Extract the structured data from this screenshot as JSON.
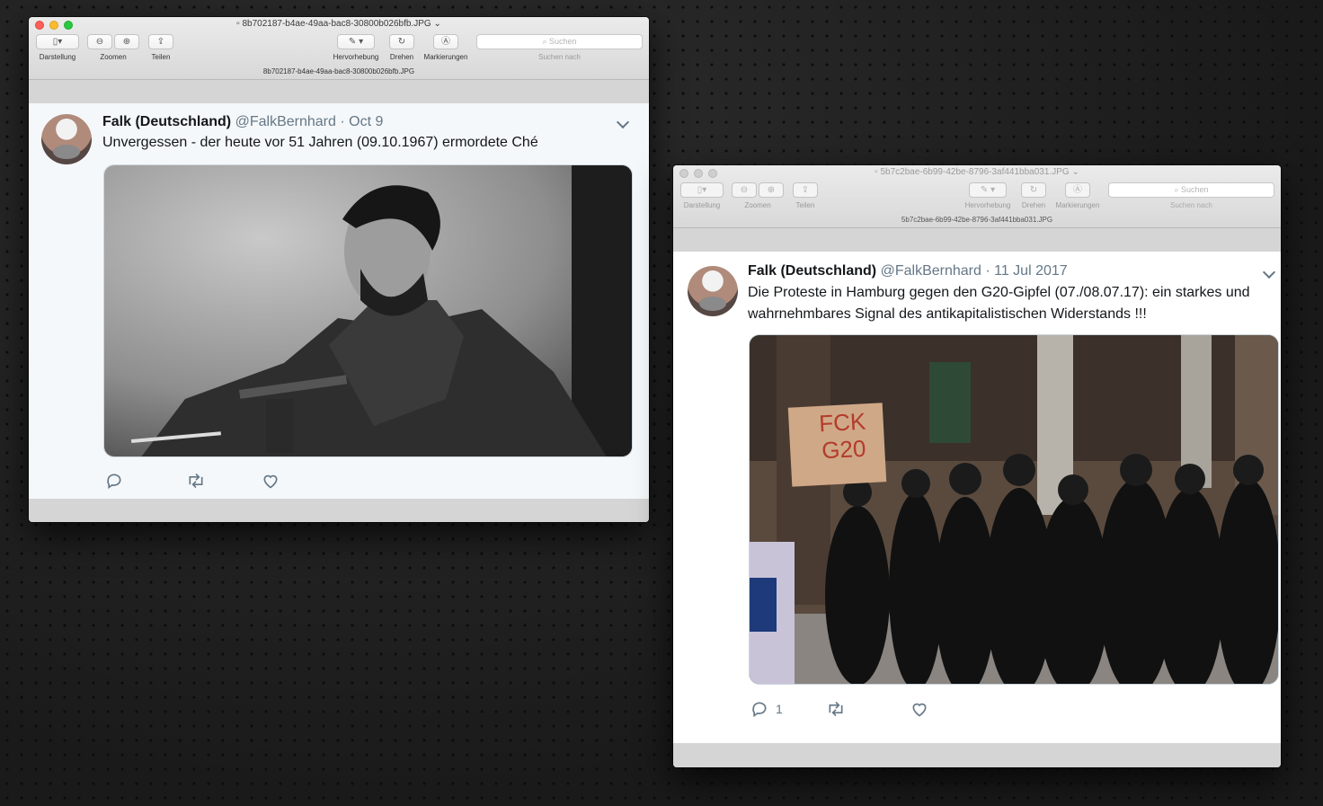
{
  "toolbar": {
    "view_label": "Darstellung",
    "zoom_label": "Zoomen",
    "share_label": "Teilen",
    "highlight_label": "Hervorhebung",
    "rotate_label": "Drehen",
    "markup_label": "Markierungen",
    "search_placeholder": "Suchen",
    "search_label": "Suchen nach"
  },
  "windows": [
    {
      "title": "8b702187-b4ae-49aa-bac8-30800b026bfb.JPG",
      "filename": "8b702187-b4ae-49aa-bac8-30800b026bfb.JPG",
      "tweet": {
        "name": "Falk (Deutschland)",
        "handle": "@FalkBernhard",
        "date": "· Oct 9",
        "text": "Unvergessen - der heute vor 51 Jahren (09.10.1967) ermordete Ché",
        "reply_count": "",
        "photo": "black-and-white-portrait-photo"
      }
    },
    {
      "title": "5b7c2bae-6b99-42be-8796-3af441bba031.JPG",
      "filename": "5b7c2bae-6b99-42be-8796-3af441bba031.JPG",
      "tweet": {
        "name": "Falk (Deutschland)",
        "handle": "@FalkBernhard",
        "date": "· 11 Jul 2017",
        "text": "Die Proteste in Hamburg gegen den G20-Gipfel (07./08.07.17): ein starkes und wahrnehmbares Signal des antikapitalistischen Widerstands !!!",
        "reply_count": "1",
        "sign_text": "FCK G20",
        "photo": "protest-crowd-photo"
      }
    }
  ],
  "colors": {
    "accent_text": "#14171a",
    "muted": "#657786",
    "tl_red": "#fc5f57",
    "tl_yellow": "#fdbc2e",
    "tl_green": "#28c940"
  }
}
